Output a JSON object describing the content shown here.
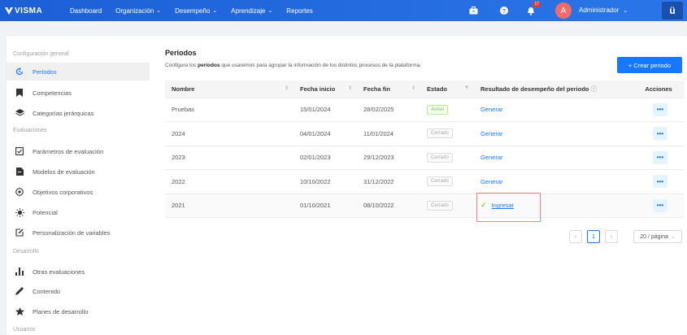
{
  "topnav": {
    "brand": "VISMA",
    "items": [
      {
        "label": "Dashboard",
        "dropdown": false
      },
      {
        "label": "Organización",
        "dropdown": true
      },
      {
        "label": "Desempeño",
        "dropdown": true
      },
      {
        "label": "Aprendizaje",
        "dropdown": true
      },
      {
        "label": "Reportes",
        "dropdown": false
      }
    ],
    "notification_count": "17",
    "avatar_letter": "A",
    "user": "Administrador",
    "corner_label": "ü",
    "colors": {
      "bar": "#1d5fd6",
      "avatar": "#f36a6a"
    }
  },
  "sidebar": {
    "section_config": "Configuración general",
    "section_eval": "Evaluaciones",
    "section_dev": "Desarrollo",
    "section_users": "Usuarios",
    "items": [
      {
        "label": "Periodos",
        "icon": "period-icon"
      },
      {
        "label": "Competencias",
        "icon": "bookmark-icon"
      },
      {
        "label": "Categorías jerárquicas",
        "icon": "layers-icon"
      },
      {
        "label": "Parámetros de evaluación",
        "icon": "checkbox-icon"
      },
      {
        "label": "Modelos de evaluación",
        "icon": "document-icon"
      },
      {
        "label": "Objetivos corporativos",
        "icon": "target-icon"
      },
      {
        "label": "Potencial",
        "icon": "sun-icon"
      },
      {
        "label": "Personalización de variables",
        "icon": "edit-icon"
      },
      {
        "label": "Otras evaluaciones",
        "icon": "bar-chart-icon"
      },
      {
        "label": "Contenido",
        "icon": "pencil-icon"
      },
      {
        "label": "Planes de desarrollo",
        "icon": "star-icon"
      }
    ]
  },
  "main": {
    "title": "Periodos",
    "desc_before": "Configura los ",
    "desc_bold": "periodos",
    "desc_after": " que usaremos para agrupar la información de los distintos procesos de la plataforma.",
    "create_button": "+ Crear periodo",
    "columns": {
      "nombre": "Nombre",
      "inicio": "Fecha inicio",
      "fin": "Fecha fin",
      "estado": "Estado",
      "resultado": "Resultado de desempeño del periodo",
      "acciones": "Acciones"
    },
    "rows": [
      {
        "nombre": "Pruebas",
        "inicio": "15/01/2024",
        "fin": "28/02/2025",
        "estado": "Activo",
        "resultado": "Generar"
      },
      {
        "nombre": "2024",
        "inicio": "04/01/2024",
        "fin": "11/01/2024",
        "estado": "Cerrado",
        "resultado": "Generar"
      },
      {
        "nombre": "2023",
        "inicio": "02/01/2023",
        "fin": "29/12/2023",
        "estado": "Cerrado",
        "resultado": "Generar"
      },
      {
        "nombre": "2022",
        "inicio": "10/10/2022",
        "fin": "31/12/2022",
        "estado": "Cerrado",
        "resultado": "Generar"
      },
      {
        "nombre": "2021",
        "inicio": "01/10/2021",
        "fin": "08/10/2022",
        "estado": "Cerrado",
        "resultado": "Ingresar"
      }
    ],
    "actions_label": "•••",
    "pagination": {
      "current": "1",
      "per_page": "20 / página"
    }
  }
}
